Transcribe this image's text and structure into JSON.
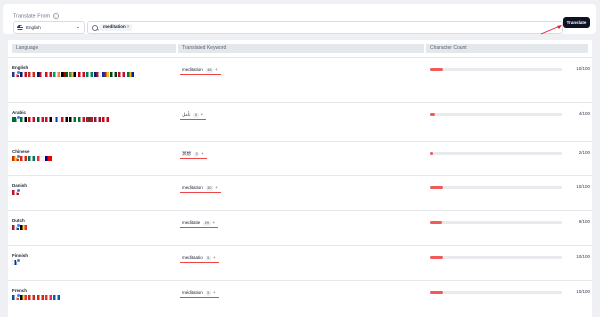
{
  "header": {
    "translate_from_label": "Translate From",
    "info_icon": "info-icon",
    "source_language": "English",
    "keyword_chip": "meditation",
    "translate_button": "Translate"
  },
  "table": {
    "columns": [
      "Language",
      "Translated Keyword",
      "Character Count"
    ],
    "rows": [
      {
        "language": "English",
        "keyword": "meditation",
        "count_badge": "48",
        "char_count": "10/100",
        "fill": 0.1,
        "flags": [
          [
            "#1f3a8a",
            "#fff",
            "#c8102e"
          ],
          [
            "#012169",
            "#fff",
            "#c8102e"
          ],
          [
            "#d52b1e",
            "#fff",
            "#d52b1e"
          ],
          [
            "#012169",
            "#c8102e",
            "#fff"
          ],
          [
            "#c8102e",
            "#fff",
            "#c8102e"
          ],
          [
            "#169b62",
            "#fff",
            "#ff883e"
          ],
          [
            "#000",
            "#bb0000",
            "#006600"
          ],
          [
            "#4a8c3a",
            "#f7c35f",
            "#000"
          ],
          [
            "#d80621",
            "#fff",
            "#d80621"
          ],
          [
            "#008751",
            "#fff",
            "#008751"
          ],
          [
            "#00247d",
            "#cf142b",
            "#fff"
          ],
          [
            "#0038a8",
            "#ce1126",
            "#fcd116"
          ],
          [
            "#01411c",
            "#fff",
            "#01411c"
          ],
          [
            "#c8102e",
            "#fff",
            "#c8102e"
          ],
          [
            "#007a4d",
            "#ffb612",
            "#002395"
          ]
        ]
      },
      {
        "language": "Arabic",
        "keyword": "تأمل",
        "count_badge": "5",
        "char_count": "4/100",
        "fill": 0.04,
        "flags": [
          [
            "#006c35",
            "#006c35",
            "#fff"
          ],
          [
            "#00732f",
            "#fff",
            "#000"
          ],
          [
            "#ce1126",
            "#fff",
            "#ce1126"
          ],
          [
            "#006233",
            "#fff",
            "#d21034"
          ],
          [
            "#ce1126",
            "#fff",
            "#000"
          ],
          [
            "#fff",
            "#0038b8",
            "#fff"
          ],
          [
            "#ce1126",
            "#fff",
            "#000"
          ],
          [
            "#000",
            "#fff",
            "#007a3d"
          ],
          [
            "#007a3d",
            "#fff",
            "#ce1126"
          ],
          [
            "#ce1126",
            "#006233",
            "#ce1126"
          ],
          [
            "#8d1b3d",
            "#fff",
            "#8d1b3d"
          ],
          [
            "#e70013",
            "#fff",
            "#e70013"
          ]
        ]
      },
      {
        "language": "Chinese",
        "keyword": "冥想",
        "count_badge": "3",
        "char_count": "2/100",
        "fill": 0.02,
        "flags": [
          [
            "#de2910",
            "#ffde00",
            "#de2910"
          ],
          [
            "#de2910",
            "#fff",
            "#de2910"
          ],
          [
            "#00785e",
            "#fff",
            "#00785e"
          ],
          [
            "#ef3340",
            "#fff",
            "#fff"
          ],
          [
            "#000095",
            "#fe0000",
            "#fe0000"
          ]
        ]
      },
      {
        "language": "Danish",
        "keyword": "meditation",
        "count_badge": "30",
        "char_count": "10/100",
        "fill": 0.1,
        "flags": [
          [
            "#c8102e",
            "#fff",
            "#c8102e"
          ]
        ]
      },
      {
        "language": "Dutch",
        "keyword": "meditatie",
        "count_badge": "29",
        "char_count": "9/100",
        "fill": 0.09,
        "flags": [
          [
            "#ae1c28",
            "#fff",
            "#21468b"
          ],
          [
            "#000",
            "#fdda24",
            "#ef3340"
          ]
        ]
      },
      {
        "language": "Finnish",
        "keyword": "meditaatio",
        "count_badge": "5",
        "char_count": "10/100",
        "fill": 0.1,
        "flags": [
          [
            "#fff",
            "#003580",
            "#fff"
          ]
        ]
      },
      {
        "language": "French",
        "keyword": "méditation",
        "count_badge": "5",
        "char_count": "10/100",
        "fill": 0.1,
        "flags": [
          [
            "#0055a4",
            "#fff",
            "#ef4135"
          ],
          [
            "#000",
            "#fdda24",
            "#ef3340"
          ],
          [
            "#d52b1e",
            "#fff",
            "#d52b1e"
          ],
          [
            "#d52b1e",
            "#fff",
            "#d52b1e"
          ],
          [
            "#ef3340",
            "#fff",
            "#ef3340"
          ],
          [
            "#0066b3",
            "#fff",
            "#0066b3"
          ]
        ]
      }
    ]
  },
  "colors": {
    "accent": "#ef4444",
    "button": "#0d1224",
    "header_bg": "#e4e7ec"
  }
}
